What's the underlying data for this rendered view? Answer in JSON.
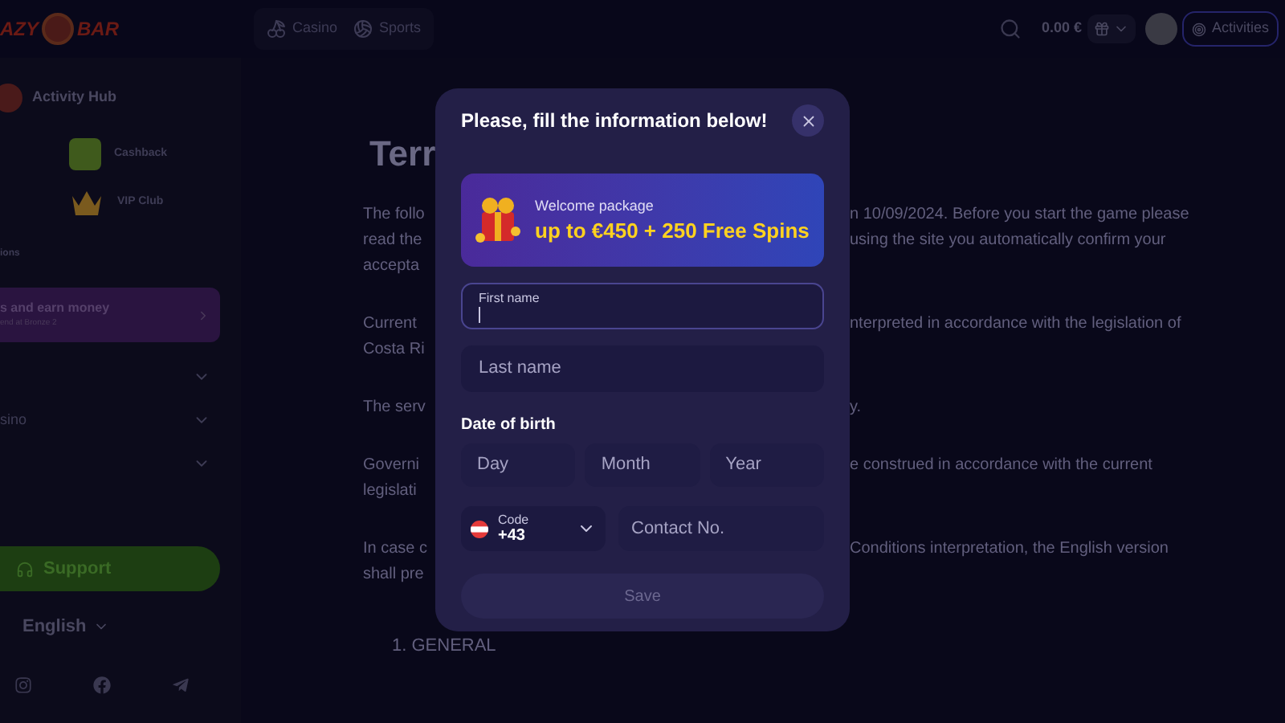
{
  "header": {
    "logo": [
      "AZY",
      "BAR"
    ],
    "nav": [
      {
        "kind": "casino",
        "label": "Casino"
      },
      {
        "kind": "sports",
        "label": "Sports"
      }
    ],
    "balance": "0.00 €",
    "activities": "Activities"
  },
  "sidebar": {
    "hub": "Activity Hub",
    "tiles": [
      {
        "kind": "cashback",
        "label": "Cashback"
      },
      {
        "kind": "vip",
        "label": "VIP Club"
      }
    ],
    "section": "ions",
    "promo": {
      "title": "s and earn money",
      "subtitle": "end at Bronze 2"
    },
    "menu": [
      {
        "kind": "blank"
      },
      {
        "kind": "labeled",
        "label": "sino"
      },
      {
        "kind": "blank"
      }
    ],
    "support": "Support",
    "language": "English"
  },
  "page": {
    "title": "Terr",
    "paragraphs": [
      {
        "left": [
          "The follo",
          "read the",
          "accepta"
        ],
        "right": [
          "n 10/09/2024. Before you start the game please",
          "using the site you automatically confirm your"
        ]
      },
      {
        "left": [
          "Current",
          "Costa Ri"
        ],
        "right": [
          "nterpreted in accordance with the legislation of"
        ]
      },
      {
        "left": [
          "The serv"
        ],
        "right": [
          "y."
        ]
      },
      {
        "left": [
          "Governi",
          "legislati"
        ],
        "right": [
          "e construed in accordance with the  current"
        ]
      },
      {
        "left": [
          "In case c",
          "shall pre"
        ],
        "right": [
          "Conditions interpretation, the English version"
        ]
      }
    ],
    "section": "1. GENERAL"
  },
  "modal": {
    "title": "Please, fill the information below!",
    "promo": {
      "kicker": "Welcome package",
      "offer": "up to €450 + 250 Free Spins"
    },
    "fields": [
      {
        "label": "First name",
        "focused": true
      },
      {
        "placeholder": "Last name",
        "focused": false
      }
    ],
    "dob": {
      "label": "Date of birth",
      "fields": [
        "Day",
        "Month",
        "Year"
      ]
    },
    "phone": {
      "code_label": "Code",
      "code": "+43",
      "placeholder": "Contact No."
    },
    "save": {
      "label": "Save",
      "disabled": true
    }
  }
}
